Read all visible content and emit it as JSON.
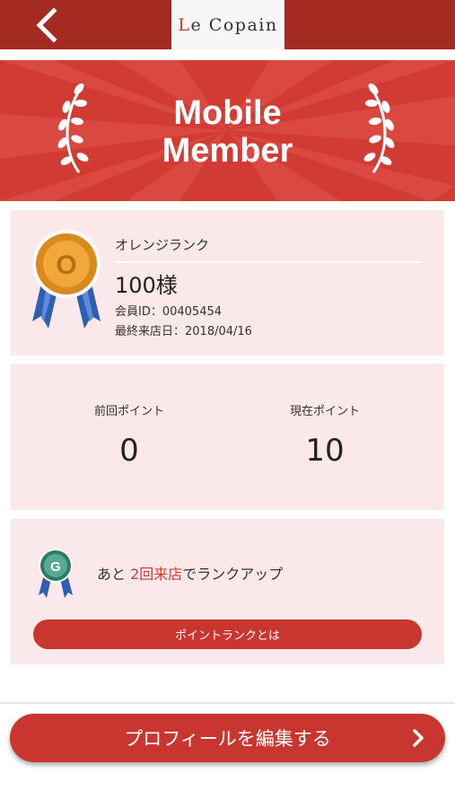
{
  "header": {
    "back_icon": "chevron-left-icon",
    "logo_initial": "L",
    "logo_rest": "e Copain",
    "background_color": "#a42a22"
  },
  "banner": {
    "title_line1": "Mobile",
    "title_line2": "Member",
    "background_color": "#d23b33",
    "decoration_icon": "laurel-icon"
  },
  "member": {
    "rank_name": "オレンジランク",
    "rank_medal_letter": "O",
    "name": "100様",
    "member_id": "会員ID：00405454",
    "last_visit": "最終来店日：2018/04/16"
  },
  "points": {
    "previous_label": "前回ポイント",
    "previous_value": "0",
    "current_label": "現在ポイント",
    "current_value": "10"
  },
  "rankup": {
    "next_medal_letter": "G",
    "text_before": "あと ",
    "text_highlight": "2回来店",
    "text_after": "でランクアップ",
    "info_button_label": "ポイントランクとは",
    "highlight_color": "#d23b33"
  },
  "footer": {
    "edit_profile_label": "プロフィールを編集する",
    "edit_icon": "chevron-right-icon",
    "button_color": "#c8362f"
  }
}
